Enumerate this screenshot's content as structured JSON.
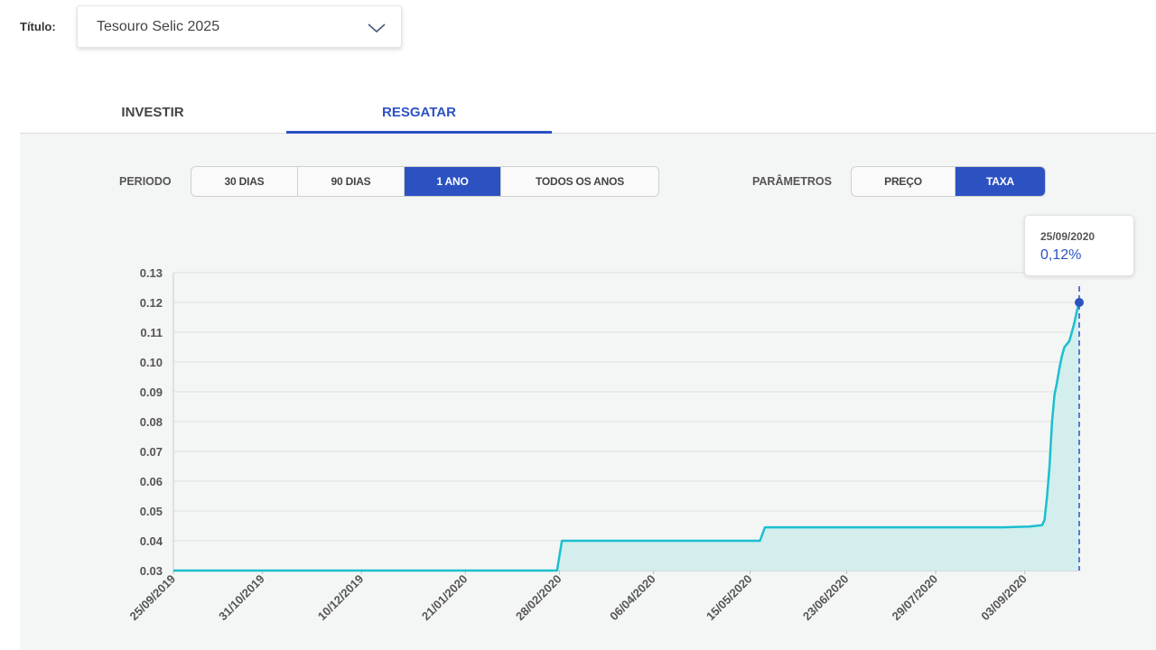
{
  "header": {
    "title_label": "Título:",
    "title_value": "Tesouro Selic 2025",
    "dropdown_icon": "chevron-down-icon"
  },
  "tabs": [
    {
      "label": "INVESTIR",
      "active": false
    },
    {
      "label": "RESGATAR",
      "active": true
    }
  ],
  "controls": {
    "period_label": "PERIODO",
    "period_options": [
      {
        "label": "30 DIAS",
        "active": false
      },
      {
        "label": "90 DIAS",
        "active": false
      },
      {
        "label": "1 ANO",
        "active": true
      },
      {
        "label": "TODOS OS ANOS",
        "active": false
      }
    ],
    "params_label": "PARÂMETROS",
    "param_options": [
      {
        "label": "PREÇO",
        "active": false
      },
      {
        "label": "TAXA",
        "active": true
      }
    ]
  },
  "tooltip": {
    "date": "25/09/2020",
    "value": "0,12%"
  },
  "colors": {
    "accent": "#2c52c2",
    "line": "#1bbfcf",
    "fill": "#d3eeed"
  },
  "chart_data": {
    "type": "area",
    "title": "",
    "xlabel": "",
    "ylabel": "",
    "x_tick_labels": [
      "25/09/2019",
      "31/10/2019",
      "10/12/2019",
      "21/01/2020",
      "28/02/2020",
      "06/04/2020",
      "15/05/2020",
      "23/06/2020",
      "29/07/2020",
      "03/09/2020"
    ],
    "y_ticks": [
      "0.03",
      "0.04",
      "0.05",
      "0.06",
      "0.07",
      "0.08",
      "0.09",
      "0.10",
      "0.11",
      "0.12",
      "0.13"
    ],
    "ylim": [
      0.03,
      0.13
    ],
    "xlim": [
      "2019-09-25",
      "2020-09-25"
    ],
    "grid": true,
    "series": [
      {
        "x": [
          "2019-09-25",
          "2020-02-27",
          "2020-02-29",
          "2020-05-19",
          "2020-05-21",
          "2020-08-25",
          "2020-09-05",
          "2020-09-10",
          "2020-09-11",
          "2020-09-12",
          "2020-09-13",
          "2020-09-14",
          "2020-09-15",
          "2020-09-16",
          "2020-09-17",
          "2020-09-18",
          "2020-09-19",
          "2020-09-20",
          "2020-09-21",
          "2020-09-22",
          "2020-09-23",
          "2020-09-24",
          "2020-09-25"
        ],
        "y": [
          0.03,
          0.03,
          0.04,
          0.04,
          0.0445,
          0.0445,
          0.0448,
          0.0452,
          0.047,
          0.055,
          0.065,
          0.08,
          0.089,
          0.093,
          0.098,
          0.102,
          0.105,
          0.106,
          0.107,
          0.11,
          0.113,
          0.117,
          0.1205
        ]
      }
    ],
    "highlight": {
      "x": "2020-09-25",
      "y": 0.12
    }
  }
}
